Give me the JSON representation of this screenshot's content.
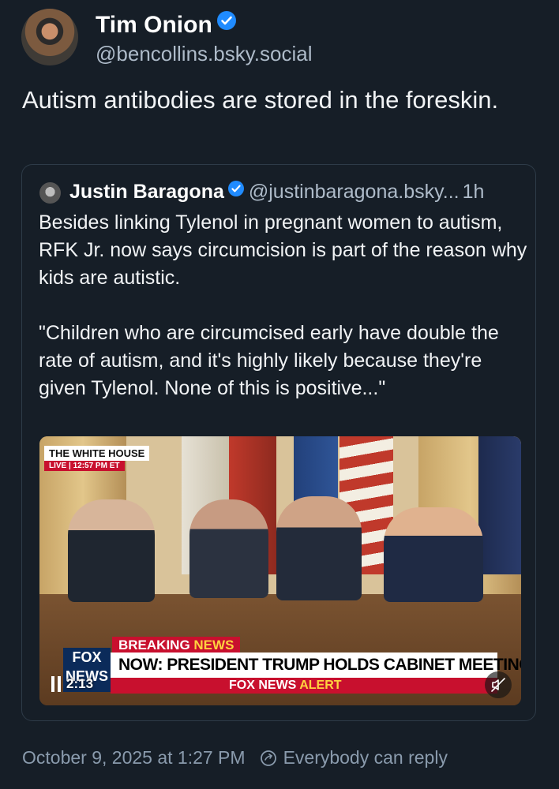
{
  "author": {
    "name": "Tim Onion",
    "handle": "@bencollins.bsky.social"
  },
  "post": {
    "text": "Autism antibodies are stored in the foreskin."
  },
  "quoted": {
    "name": "Justin Baragona",
    "handle": "@justinbaragona.bsky...",
    "time": "1h",
    "text": "Besides linking Tylenol in pregnant women to autism, RFK Jr. now says circumcision is part of the reason why kids are autistic.\n\n\"Children who are circumcised early have double the rate of autism, and it's highly likely because they're given Tylenol. None of this is positive...\""
  },
  "video": {
    "wh_title": "THE WHITE HOUSE",
    "wh_live": "LIVE | 12:57 PM ET",
    "breaking": "BREAKING",
    "breaking_news": "NEWS",
    "headline": "NOW: PRESIDENT TRUMP HOLDS CABINET MEETING",
    "alert_brand": "FOX NEWS",
    "alert_word": "ALERT",
    "logo": "FOX NEWS",
    "elapsed": "2:13"
  },
  "footer": {
    "timestamp": "October 9, 2025 at 1:27 PM",
    "reply_setting": "Everybody can reply"
  },
  "colors": {
    "background": "#161e27",
    "verified": "#208bfe",
    "muted": "#8a9bad"
  },
  "icons": [
    "verified-badge-icon",
    "pause-icon",
    "mute-icon",
    "reply-settings-icon"
  ]
}
